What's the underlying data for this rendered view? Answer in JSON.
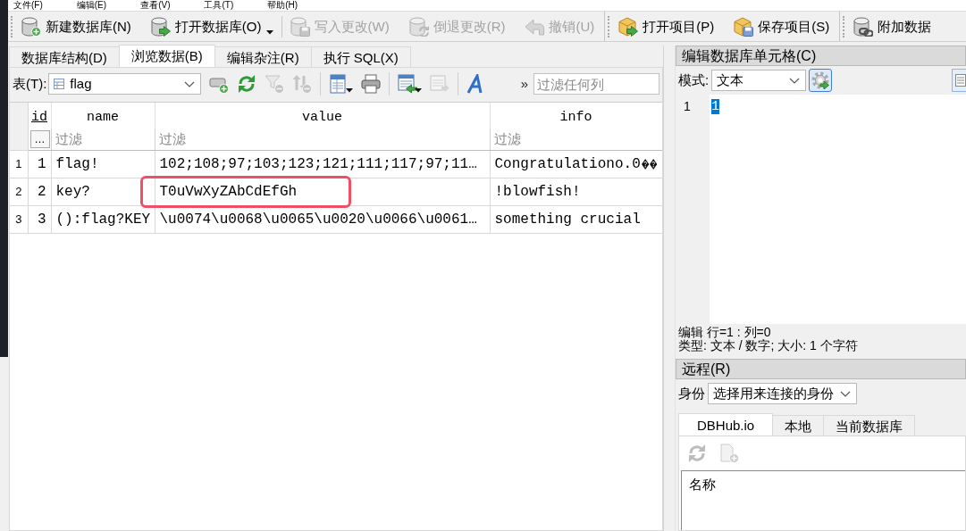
{
  "menu": [
    {
      "label": "文件(F)"
    },
    {
      "label": "编辑(E)"
    },
    {
      "label": "查看(V)"
    },
    {
      "label": "工具(T)"
    },
    {
      "label": "帮助(H)"
    }
  ],
  "toolbars": [
    {
      "sections": [
        [
          {
            "label": "新建数据库(N)",
            "disabled": false,
            "dropdown": false
          },
          {
            "label": "打开数据库(O)",
            "disabled": false,
            "dropdown": true
          }
        ],
        [
          {
            "label": "写入更改(W)",
            "disabled": true,
            "dropdown": false
          },
          {
            "label": "倒退更改(R)",
            "disabled": true,
            "dropdown": false
          },
          {
            "label": "撤销(U)",
            "disabled": true,
            "dropdown": false
          }
        ]
      ]
    },
    {
      "sections": [
        [
          {
            "label": "打开项目(P)",
            "disabled": false,
            "dropdown": false
          },
          {
            "label": "保存项目(S)",
            "disabled": false,
            "dropdown": false
          }
        ]
      ]
    },
    {
      "sections": [
        [
          {
            "label": "附加数据",
            "disabled": false,
            "dropdown": false
          }
        ]
      ]
    }
  ],
  "tabs": [
    {
      "label": "数据库结构(D)",
      "selected": false
    },
    {
      "label": "浏览数据(B)",
      "selected": true
    },
    {
      "label": "编辑杂注(R)",
      "selected": false
    },
    {
      "label": "执行 SQL(X)",
      "selected": false
    }
  ],
  "table_toolbar": {
    "table_label": "表(T):",
    "table_select": "flag",
    "tools": [
      [
        {
          "disabled": false,
          "dropdown": false
        },
        {
          "disabled": false,
          "dropdown": false
        },
        {
          "disabled": true,
          "dropdown": false
        },
        {
          "disabled": true,
          "dropdown": false
        }
      ],
      [
        {
          "disabled": false,
          "dropdown": true
        },
        {
          "disabled": false,
          "dropdown": false
        }
      ],
      [
        {
          "disabled": false,
          "dropdown": true
        },
        {
          "disabled": true,
          "dropdown": false
        }
      ],
      [
        {
          "disabled": false,
          "dropdown": false
        }
      ]
    ],
    "more": "»",
    "filter": {
      "placeholder": "过滤任何列"
    }
  },
  "table": {
    "columns": [
      {
        "label": "id",
        "primary_key": true
      },
      {
        "label": "name",
        "primary_key": false
      },
      {
        "label": "value",
        "primary_key": false
      },
      {
        "label": "info",
        "primary_key": false
      }
    ],
    "filters": [
      {
        "kind": "button",
        "label": "…"
      },
      {
        "kind": "field",
        "placeholder": "过滤"
      },
      {
        "kind": "field",
        "placeholder": "过滤"
      },
      {
        "kind": "field",
        "placeholder": "过滤"
      }
    ],
    "rows": [
      {
        "number": "1",
        "cells": [
          {
            "text": "1",
            "circled": false
          },
          {
            "text": "flag!",
            "circled": false
          },
          {
            "text": "102;108;97;103;123;121;111;117;97;11…",
            "circled": false
          },
          {
            "text": "Congratulationo.0",
            "circled": false,
            "marks": [
              {
                "kind": "replacement"
              },
              {
                "kind": "replacement"
              }
            ]
          }
        ]
      },
      {
        "number": "2",
        "cells": [
          {
            "text": "2",
            "circled": false
          },
          {
            "text": "key?",
            "circled": false
          },
          {
            "text": "T0uVwXyZAbCdEfGh",
            "circled": true
          },
          {
            "text": "!blowfish!",
            "circled": false
          }
        ]
      },
      {
        "number": "3",
        "cells": [
          {
            "text": "3",
            "circled": false
          },
          {
            "text": "():flag?KEY",
            "circled": false
          },
          {
            "text": "\\u0074\\u0068\\u0065\\u0020\\u0066\\u0061…",
            "circled": false
          },
          {
            "text": "something crucial",
            "circled": false
          }
        ]
      }
    ]
  },
  "cell_editor": {
    "title": "编辑数据库单元格(C)",
    "mode_label": "模式:",
    "mode": "文本",
    "lines": [
      {
        "number": "1",
        "text": "1",
        "selected": true
      }
    ],
    "status": [
      "编辑 行=1 : 列=0",
      "类型: 文本 / 数字; 大小: 1 个字符"
    ]
  },
  "remote": {
    "title": "远程(R)",
    "identity_label": "身份",
    "identity": "选择用来连接的身份",
    "tabs": [
      {
        "label": "DBHub.io",
        "selected": true
      },
      {
        "label": "本地",
        "selected": false
      },
      {
        "label": "当前数据库",
        "selected": false
      }
    ],
    "tools": [
      {
        "disabled": true
      },
      {
        "disabled": true
      }
    ],
    "list_header": "名称"
  }
}
